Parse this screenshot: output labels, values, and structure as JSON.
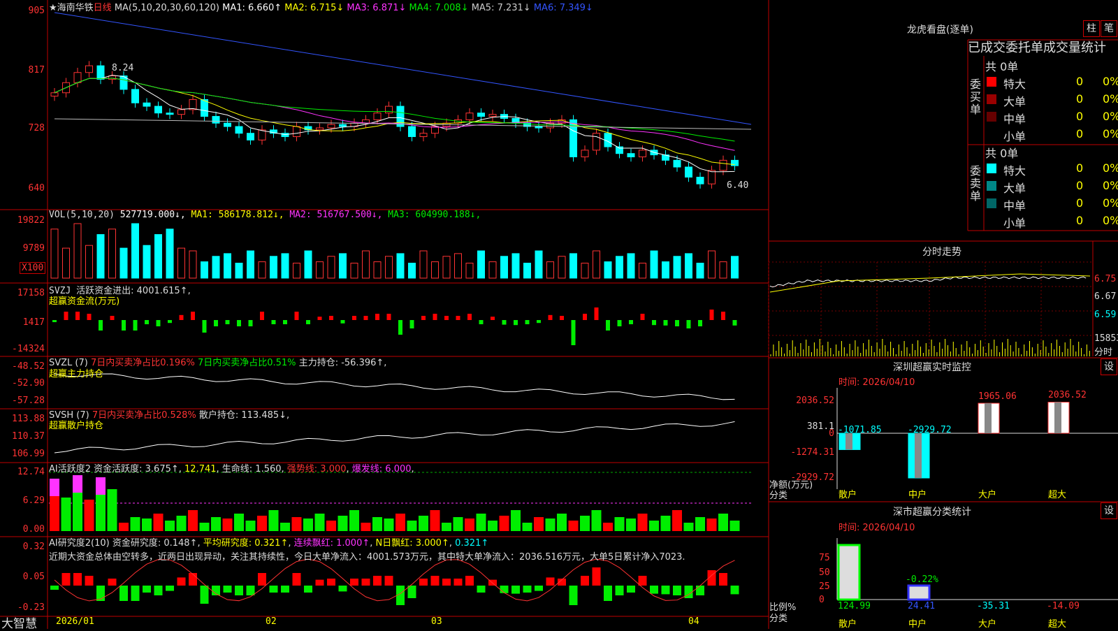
{
  "stock": {
    "name": "★海南华铁",
    "period": "日线"
  },
  "ma_header": {
    "label": "MA(5,10,20,30,60,120)",
    "items": [
      {
        "k": "MA1:",
        "v": "6.660↑",
        "c": "#fff"
      },
      {
        "k": "MA2:",
        "v": "6.715↓",
        "c": "#ffff00"
      },
      {
        "k": "MA3:",
        "v": "6.871↓",
        "c": "#ff33ff"
      },
      {
        "k": "MA4:",
        "v": "7.008↓",
        "c": "#00ee00"
      },
      {
        "k": "MA5:",
        "v": "7.231↓",
        "c": "#ccc"
      },
      {
        "k": "MA6:",
        "v": "7.349↓",
        "c": "#3355ff"
      }
    ]
  },
  "price_axis": [
    "905",
    "817",
    "728",
    "640"
  ],
  "price_marks": {
    "high": "8.24",
    "low": "6.40"
  },
  "vol_header": {
    "label": "VOL(5,10,20)",
    "items": [
      {
        "t": "527719.000↓",
        "c": "#fff"
      },
      {
        "t": "MA1: 586178.812↓",
        "c": "#ffff00"
      },
      {
        "t": "MA2: 516767.500↓",
        "c": "#ff33ff"
      },
      {
        "t": "MA3: 604990.188↓",
        "c": "#00ee00"
      }
    ]
  },
  "vol_axis": [
    "19822",
    "9789"
  ],
  "vol_unit": "X100",
  "svzj": {
    "label": "SVZJ",
    "desc": "活跃资金进出: 4001.615↑,",
    "sub": "超赢资金流(万元)",
    "axis": [
      "17158",
      "1417",
      "-14324"
    ]
  },
  "svzl": {
    "label": "SVZL (7)",
    "t1": "7日内买卖净占比0.196%",
    "t2": "7日内买卖净占比0.51%",
    "t3": "主力持仓: -56.396↑,",
    "sub": "超赢主力持仓",
    "axis": [
      "-48.52",
      "-52.90",
      "-57.28"
    ]
  },
  "svsh": {
    "label": "SVSH (7)",
    "t1": "7日内买卖净占比0.528%",
    "t2": "散户持仓: 113.485↓,",
    "sub": "超赢散户持仓",
    "axis": [
      "113.88",
      "110.37",
      "106.99"
    ]
  },
  "ai1": {
    "label": "AI活跃度2",
    "t1": "资金活跃度: 3.675↑",
    "t2": "12.741",
    "t3": "生命线: 1.560",
    "t4": "强势线: 3.000",
    "t5": "爆发线: 6.000",
    "axis": [
      "12.74",
      "6.29",
      "0.00"
    ]
  },
  "ai2": {
    "label": "AI研究度2(10)",
    "t1": "资金研究度: 0.148↑",
    "t2": "平均研究度: 0.321↑",
    "t3": "连续飘红: 1.000↑",
    "t4": "N日飘红: 3.000↑",
    "t5": "0.321↑",
    "comment": "近期大资金总体由空转多，近两日出现异动，关注其持续性，今日大单净流入：4001.573万元，其中特大单净流入：2036.516万元，大单5日累计净入7023.",
    "axis": [
      "0.32",
      "0.05",
      "-0.23"
    ]
  },
  "xdates": [
    "2026/01",
    "02",
    "03",
    "04"
  ],
  "brand": "大智慧",
  "right_panel": {
    "title": "龙虎看盘(逐单)",
    "tab1": "柱",
    "tab2": "笔",
    "table_title": "已成交委托单成交量统计",
    "buy": {
      "label": "委买单",
      "count": "共 0单",
      "rows": [
        {
          "n": "特大",
          "v": "0",
          "p": "0%",
          "c": "#ff0000"
        },
        {
          "n": "大单",
          "v": "0",
          "p": "0%",
          "c": "#990000"
        },
        {
          "n": "中单",
          "v": "0",
          "p": "0%",
          "c": "#660000"
        },
        {
          "n": "小单",
          "v": "0",
          "p": "0%",
          "c": ""
        }
      ]
    },
    "sell": {
      "label": "委卖单",
      "count": "共 0单",
      "rows": [
        {
          "n": "特大",
          "v": "0",
          "p": "0%",
          "c": "#00ffff"
        },
        {
          "n": "大单",
          "v": "0",
          "p": "0%",
          "c": "#008888"
        },
        {
          "n": "中单",
          "v": "0",
          "p": "0%",
          "c": "#006666"
        },
        {
          "n": "小单",
          "v": "0",
          "p": "0%",
          "c": ""
        }
      ]
    }
  },
  "intraday": {
    "title": "分时走势",
    "axis": [
      "6.75",
      "6.67",
      "6.59",
      "15853",
      "分时"
    ]
  },
  "sz_monitor": {
    "title": "深圳超赢实时监控",
    "btn": "设",
    "time": "时间: 2026/04/10",
    "axis": [
      "2036.52",
      "381.1",
      "0",
      "-1274.31",
      "-2929.72"
    ],
    "ylabel1": "净额(万元)",
    "ylabel2": "分类",
    "labels": [
      "-1071.85",
      "-2929.72",
      "1965.06",
      "2036.52"
    ],
    "cats": [
      "散户",
      "中户",
      "大户",
      "超大"
    ]
  },
  "sz_stat": {
    "title": "深市超赢分类统计",
    "btn": "设",
    "time": "时间: 2026/04/10",
    "axis": [
      "75",
      "50",
      "25",
      "0"
    ],
    "ylabel1": "比例%",
    "ylabel2": "分类",
    "pct": "-0.22%",
    "vals": [
      "124.99",
      "24.41",
      "-35.31",
      "-14.09"
    ],
    "cats": [
      "散户",
      "中户",
      "大户",
      "超大"
    ]
  },
  "chart_data": {
    "type": "candlestick",
    "title": "海南华铁 日线",
    "series": [
      {
        "name": "MA1",
        "last": 6.66
      },
      {
        "name": "MA2",
        "last": 6.715
      },
      {
        "name": "MA3",
        "last": 6.871
      },
      {
        "name": "MA4",
        "last": 7.008
      },
      {
        "name": "MA5",
        "last": 7.231
      },
      {
        "name": "MA6",
        "last": 7.349
      }
    ],
    "high": 8.24,
    "low": 6.4,
    "ylim": [
      6.4,
      9.05
    ],
    "x_ticks": [
      "2026/01",
      "02",
      "03",
      "04"
    ],
    "colors": {
      "up": "#ff3333",
      "down": "#00ffff"
    }
  }
}
